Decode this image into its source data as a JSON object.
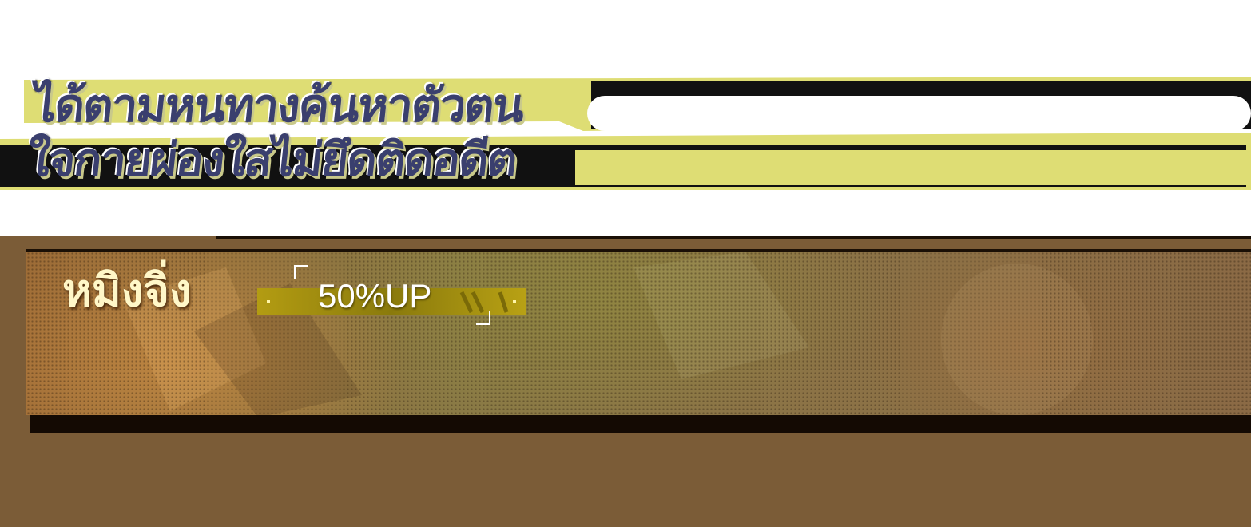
{
  "headline": {
    "line1": "ได้ตามหนทางค้นหาตัวตน",
    "line2": "ใจกายผ่องใสไม่ยึดติดอดีต"
  },
  "banner": {
    "character_name": "หมิงจิ่ง",
    "bonus": "50%UP"
  },
  "colors": {
    "headline_text": "#3a3f6e",
    "headline_stripe": "#dedd74",
    "banner_base": "#7b5c37",
    "name_text": "#fff7c8",
    "bonus_bar": "#b39c12"
  }
}
